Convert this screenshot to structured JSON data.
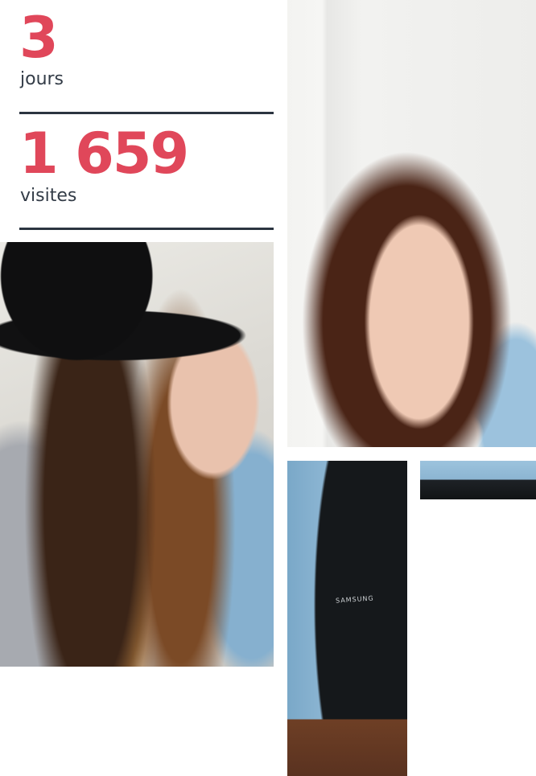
{
  "stats": [
    {
      "number": "3",
      "label": "jours"
    },
    {
      "number": "1 659",
      "label": "visites"
    }
  ],
  "photos": {
    "laptop_brand": "SAMSUNG"
  },
  "colors": {
    "accent": "#e0475a",
    "text": "#333c47",
    "rule": "#2b3440"
  }
}
